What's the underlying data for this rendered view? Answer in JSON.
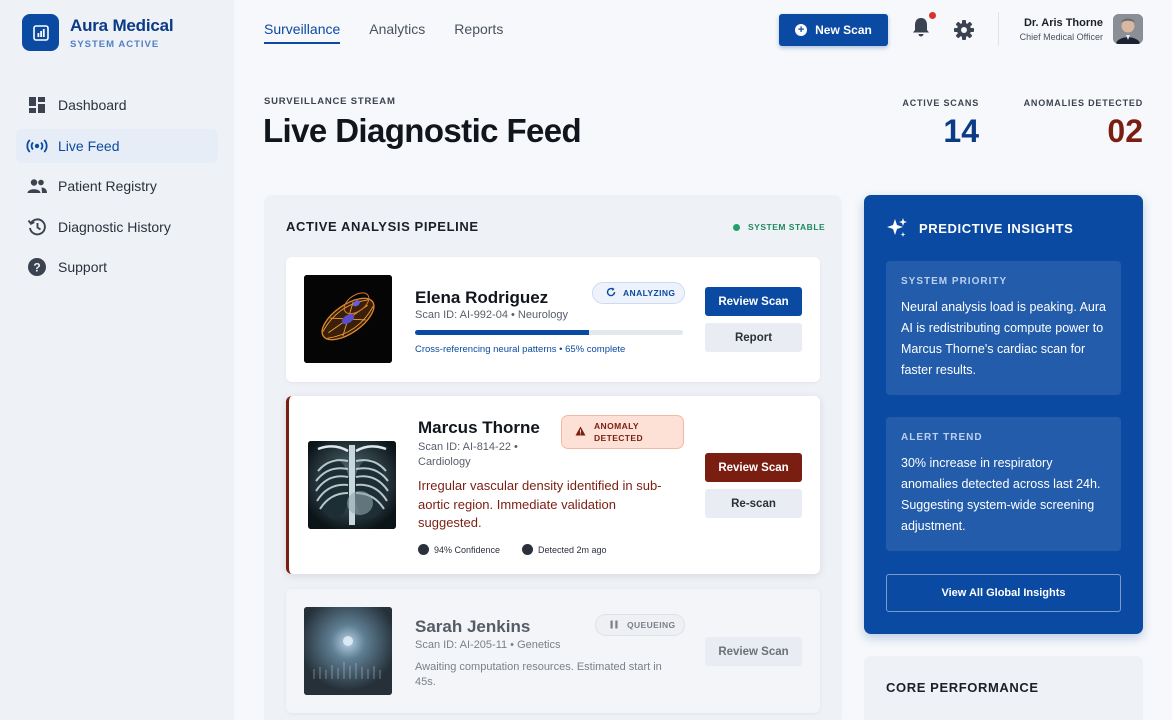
{
  "brand": {
    "name": "Aura Medical",
    "status": "SYSTEM ACTIVE"
  },
  "sidebar": {
    "items": [
      {
        "label": "Dashboard",
        "icon": "dashboard-icon",
        "active": false
      },
      {
        "label": "Live Feed",
        "icon": "broadcast-icon",
        "active": true
      },
      {
        "label": "Patient Registry",
        "icon": "users-icon",
        "active": false
      },
      {
        "label": "Diagnostic History",
        "icon": "history-icon",
        "active": false
      },
      {
        "label": "Support",
        "icon": "help-icon",
        "active": false
      }
    ]
  },
  "topnav": {
    "links": [
      {
        "label": "Surveillance",
        "active": true
      },
      {
        "label": "Analytics",
        "active": false
      },
      {
        "label": "Reports",
        "active": false
      }
    ],
    "new_scan_label": "New Scan"
  },
  "user": {
    "name": "Dr. Aris Thorne",
    "role": "Chief Medical Officer"
  },
  "header": {
    "eyebrow": "SURVEILLANCE STREAM",
    "title": "Live Diagnostic Feed",
    "stats": [
      {
        "label": "ACTIVE SCANS",
        "value": "14",
        "color": "#0b3a86"
      },
      {
        "label": "ANOMALIES DETECTED",
        "value": "02",
        "color": "#7b1e12"
      }
    ]
  },
  "pipeline": {
    "title": "ACTIVE ANALYSIS PIPELINE",
    "status": "SYSTEM STABLE",
    "scans": [
      {
        "patient": "Elena Rodriguez",
        "meta": "Scan ID: AI-992-04 • Neurology",
        "badge": "ANALYZING",
        "progress": 0.65,
        "progress_note": "Cross-referencing neural patterns • 65% complete",
        "primary_label": "Review Scan",
        "secondary_label": "Report"
      },
      {
        "patient": "Marcus Thorne",
        "meta_line1": "Scan ID: AI-814-22 •",
        "meta_line2": "Cardiology",
        "badge_line1": "ANOMALY",
        "badge_line2": "DETECTED",
        "alert": "Irregular vascular density identified in sub-aortic region. Immediate validation suggested.",
        "confidence": "94% Confidence",
        "detected": "Detected 2m ago",
        "primary_label": "Review Scan",
        "secondary_label": "Re-scan"
      },
      {
        "patient": "Sarah Jenkins",
        "meta": "Scan ID: AI-205-11 • Genetics",
        "badge": "QUEUEING",
        "note": "Awaiting computation resources. Estimated start in 45s.",
        "primary_label": "Review Scan"
      }
    ]
  },
  "insights": {
    "title": "PREDICTIVE INSIGHTS",
    "blocks": [
      {
        "label": "SYSTEM PRIORITY",
        "text": "Neural analysis load is peaking. Aura AI is redistributing compute power to Marcus Thorne's cardiac scan for faster results."
      },
      {
        "label": "ALERT TREND",
        "text": "30% increase in respiratory anomalies detected across last 24h. Suggesting system-wide screening adjustment."
      }
    ],
    "button_label": "View All Global Insights"
  },
  "core": {
    "title": "CORE PERFORMANCE"
  }
}
